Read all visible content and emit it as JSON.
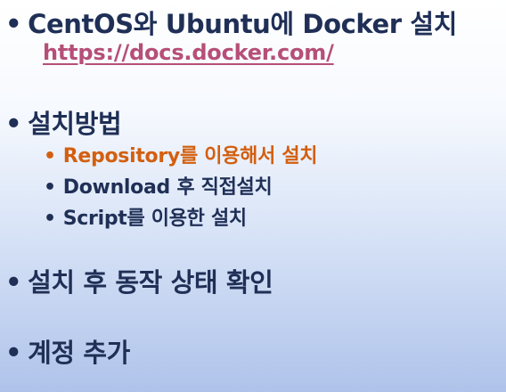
{
  "slide": {
    "bullet_symbol": "•",
    "items": [
      {
        "text": "CentOS와 Ubuntu에 Docker 설치"
      },
      {
        "link": "https://docs.docker.com/"
      },
      {
        "text": "설치방법"
      },
      {
        "text": "Repository를 이용해서 설치",
        "highlight": true
      },
      {
        "text": "Download 후 직접설치"
      },
      {
        "text": "Script를 이용한 설치"
      },
      {
        "text": "설치 후 동작 상태 확인"
      },
      {
        "text": "계정 추가"
      }
    ]
  },
  "colors": {
    "text": "#1f2f56",
    "link": "#b64f78",
    "highlight": "#d35f0f",
    "background_top": "#ffffff",
    "background_bottom": "#afc3ea"
  }
}
